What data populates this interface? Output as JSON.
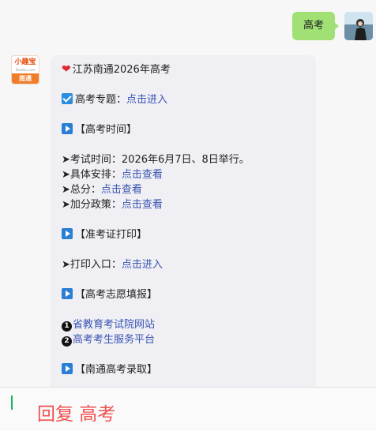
{
  "user_message": {
    "text": "高考"
  },
  "bot": {
    "avatar": {
      "logo_text": "小趣宝",
      "site_text": "Eeeduu.com",
      "city_text": "南通"
    },
    "title": "江苏南通2026年高考",
    "topic": {
      "label": "高考专题：",
      "link": "点击进入"
    },
    "section1": {
      "heading": "【高考时间】"
    },
    "exam_time": {
      "label": "➤考试时间：",
      "value": "2026年6月7日、8日举行。"
    },
    "schedule": {
      "label": "➤具体安排：",
      "link": "点击查看"
    },
    "total": {
      "label": "➤总分：",
      "link": "点击查看"
    },
    "bonus": {
      "label": "➤加分政策：",
      "link": "点击查看"
    },
    "section2": {
      "heading": "【准考证打印】"
    },
    "print": {
      "label": "➤打印入口：",
      "link": "点击进入"
    },
    "section3": {
      "heading": "【高考志愿填报】"
    },
    "link1": {
      "num": "1",
      "text": "省教育考试院网站"
    },
    "link2": {
      "num": "2",
      "text": "高考考生服务平台"
    },
    "section4": {
      "heading": "【南通高考录取】"
    }
  },
  "reply": {
    "hint": "回复 高考"
  },
  "colors": {
    "link": "#3a55b2",
    "user_bubble": "#a0e074",
    "bot_bubble": "#efeff4",
    "hint": "#f05050"
  }
}
